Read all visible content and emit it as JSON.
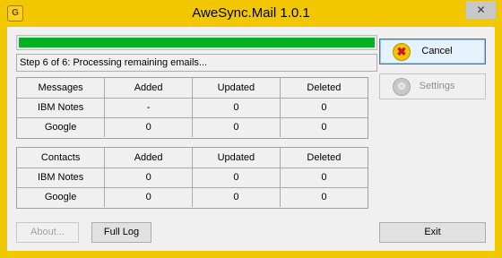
{
  "window": {
    "title": "AweSync.Mail 1.0.1",
    "app_icon_glyph": "G",
    "close_glyph": "✕"
  },
  "progress": {
    "fraction": 1.0,
    "color": "#06b025"
  },
  "status_text": "Step 6 of 6: Processing remaining emails...",
  "messages_table": {
    "headers": [
      "Messages",
      "Added",
      "Updated",
      "Deleted"
    ],
    "rows": [
      [
        "IBM Notes",
        "-",
        "0",
        "0"
      ],
      [
        "Google",
        "0",
        "0",
        "0"
      ]
    ]
  },
  "contacts_table": {
    "headers": [
      "Contacts",
      "Added",
      "Updated",
      "Deleted"
    ],
    "rows": [
      [
        "IBM Notes",
        "0",
        "0",
        "0"
      ],
      [
        "Google",
        "0",
        "0",
        "0"
      ]
    ]
  },
  "buttons": {
    "cancel": "Cancel",
    "settings": "Settings",
    "about": "About...",
    "full_log": "Full Log",
    "exit": "Exit"
  },
  "icons": {
    "cancel": "cancel-icon",
    "settings": "settings-icon",
    "app": "app-icon",
    "close": "close-icon"
  }
}
